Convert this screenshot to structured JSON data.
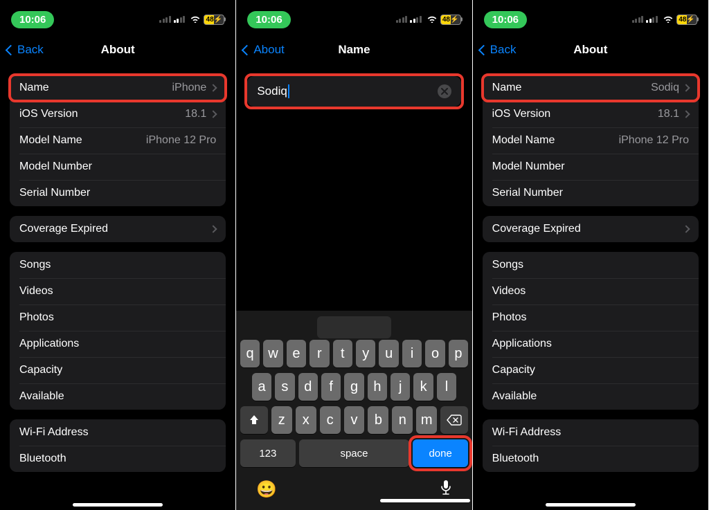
{
  "status": {
    "time": "10:06",
    "battery_text": "48"
  },
  "panels": {
    "left": {
      "back_label": "Back",
      "title": "About",
      "rows": {
        "name_label": "Name",
        "name_value": "iPhone",
        "ios_label": "iOS Version",
        "ios_value": "18.1",
        "model_label": "Model Name",
        "model_value": "iPhone 12 Pro",
        "modelnum_label": "Model Number",
        "serial_label": "Serial Number",
        "coverage_label": "Coverage Expired",
        "songs": "Songs",
        "videos": "Videos",
        "photos": "Photos",
        "apps": "Applications",
        "capacity": "Capacity",
        "available": "Available",
        "wifi": "Wi-Fi Address",
        "bt": "Bluetooth"
      }
    },
    "mid": {
      "back_label": "About",
      "title": "Name",
      "input_value": "Sodiq",
      "keys": {
        "num": "123",
        "space": "space",
        "done": "done"
      }
    },
    "right": {
      "back_label": "Back",
      "title": "About",
      "name_value": "Sodiq"
    }
  },
  "colors": {
    "accent": "#0a84ff",
    "highlight": "#e8382d",
    "green_pill": "#34c759"
  }
}
